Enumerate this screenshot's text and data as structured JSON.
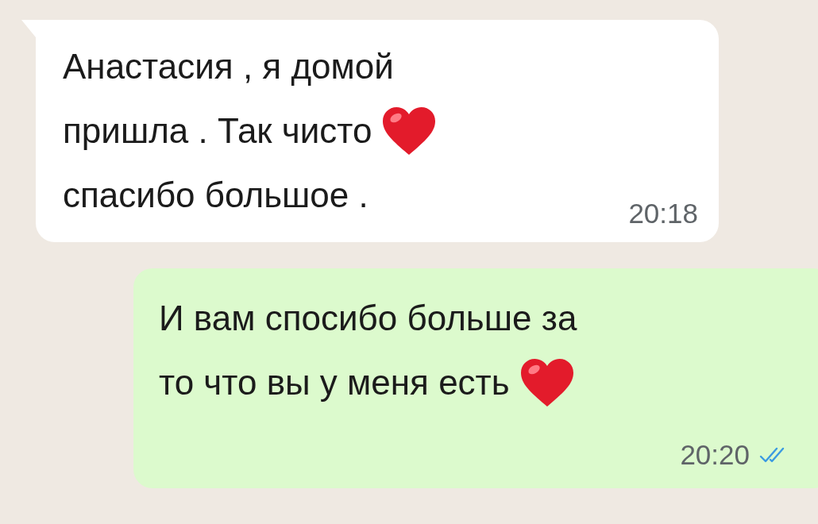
{
  "messages": [
    {
      "kind": "incoming",
      "lines": [
        {
          "kind": "plain",
          "text": "Анастасия , я домой"
        },
        {
          "kind": "heart",
          "text": "пришла . Так чисто"
        },
        {
          "kind": "plain",
          "text": "спасибо большое ."
        }
      ],
      "time": "20:18"
    },
    {
      "kind": "outgoing",
      "lines": [
        {
          "kind": "plain",
          "text": "И вам спосибо больше за"
        },
        {
          "kind": "heart",
          "text": "то что вы у меня есть"
        }
      ],
      "time": "20:20",
      "read": true
    }
  ]
}
